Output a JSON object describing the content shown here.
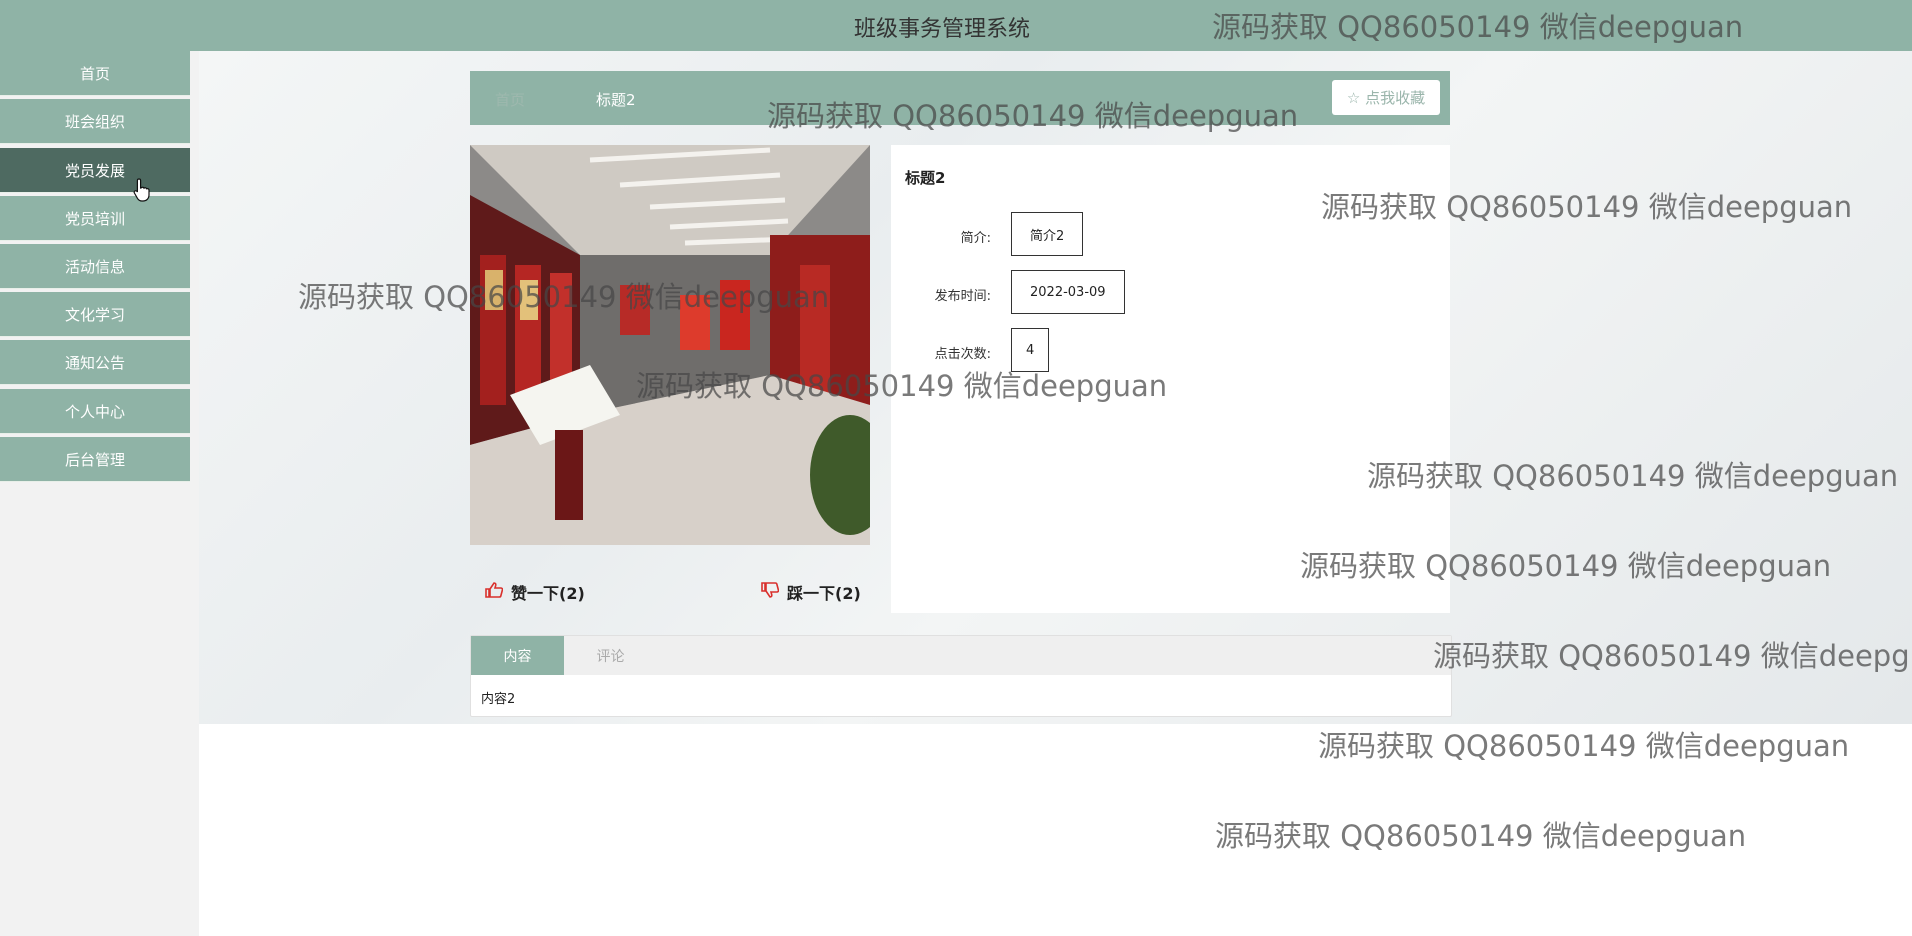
{
  "app": {
    "title": "班级事务管理系统"
  },
  "sidebar": {
    "items": [
      {
        "label": "首页"
      },
      {
        "label": "班会组织"
      },
      {
        "label": "党员发展"
      },
      {
        "label": "党员培训"
      },
      {
        "label": "活动信息"
      },
      {
        "label": "文化学习"
      },
      {
        "label": "通知公告"
      },
      {
        "label": "个人中心"
      },
      {
        "label": "后台管理"
      }
    ],
    "active_index": 2
  },
  "breadcrumb": {
    "home": "首页",
    "current": "标题2"
  },
  "favorite": {
    "label": "☆ 点我收藏"
  },
  "votes": {
    "like_label": "赞一下(2)",
    "dislike_label": "踩一下(2)"
  },
  "detail": {
    "title": "标题2",
    "fields": [
      {
        "label": "简介:",
        "value": "简介2"
      },
      {
        "label": "发布时间:",
        "value": "2022-03-09"
      },
      {
        "label": "点击次数:",
        "value": "4"
      }
    ]
  },
  "tabs": {
    "items": [
      "内容",
      "评论"
    ],
    "active": "内容",
    "content": "内容2"
  },
  "watermark": {
    "text": "源码获取 QQ86050149 微信deepguan"
  },
  "colors": {
    "theme": "#8fb3a6",
    "active_nav": "#4e6a61",
    "like": "#d9302c"
  }
}
